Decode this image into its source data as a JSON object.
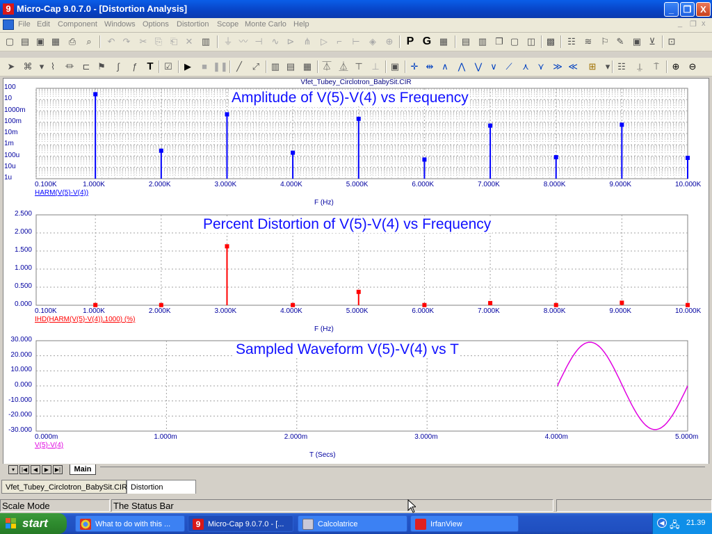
{
  "window": {
    "title": "Micro-Cap 9.0.7.0 - [Distortion Analysis]",
    "app_icon": "9",
    "controls": [
      "_",
      "❐",
      "X"
    ]
  },
  "menu": [
    "File",
    "Edit",
    "Component",
    "Windows",
    "Options",
    "Distortion",
    "Scope",
    "Monte Carlo",
    "Help"
  ],
  "toolbar_text": {
    "p": "P",
    "g": "G",
    "text_tool": "T"
  },
  "plot": {
    "filename": "Vfet_Tubey_Circlotron_BabySit.CIR",
    "colors": {
      "harm": "#0000ff",
      "ihd": "#ff0000",
      "wave": "#e000e0",
      "grid": "#a0a0a0",
      "text": "#0000a0"
    },
    "panels": [
      {
        "title": "Amplitude of V(5)-V(4) vs Frequency",
        "y_ticks": [
          "100",
          "10",
          "1000m",
          "100m",
          "10m",
          "1m",
          "100u",
          "10u",
          "1u"
        ],
        "x_ticks": [
          "0.100K",
          "1.000K",
          "2.000K",
          "3.000K",
          "4.000K",
          "5.000K",
          "6.000K",
          "7.000K",
          "8.000K",
          "9.000K",
          "10.000K"
        ],
        "x_label": "F (Hz)",
        "trace": "HARM(V(5)-V(4))"
      },
      {
        "title": "Percent Distortion of V(5)-V(4) vs Frequency",
        "y_ticks": [
          "2.500",
          "2.000",
          "1.500",
          "1.000",
          "0.500",
          "0.000"
        ],
        "x_ticks": [
          "0.100K",
          "1.000K",
          "2.000K",
          "3.000K",
          "4.000K",
          "5.000K",
          "6.000K",
          "7.000K",
          "8.000K",
          "9.000K",
          "10.000K"
        ],
        "x_label": "F (Hz)",
        "trace": "IHD(HARM(V(5)-V(4)),1000) (%)"
      },
      {
        "title": "Sampled Waveform  V(5)-V(4) vs T",
        "y_ticks": [
          "30.000",
          "20.000",
          "10.000",
          "0.000",
          "-10.000",
          "-20.000",
          "-30.000"
        ],
        "x_ticks": [
          "0.000m",
          "1.000m",
          "2.000m",
          "3.000m",
          "4.000m",
          "5.000m"
        ],
        "x_label": "T (Secs)",
        "trace": "V(5)-V(4)"
      }
    ]
  },
  "chart_data": [
    {
      "type": "bar",
      "title": "Amplitude of V(5)-V(4) vs Frequency",
      "xlabel": "F (Hz)",
      "ylabel": "",
      "series": [
        {
          "name": "HARM(V(5)-V(4))",
          "x": [
            1000,
            2000,
            3000,
            4000,
            5000,
            6000,
            7000,
            8000,
            9000,
            10000
          ],
          "values": [
            30,
            0.0003,
            0.5,
            0.0002,
            0.2,
            5e-05,
            0.05,
            8e-05,
            0.06,
            7e-05
          ]
        }
      ],
      "xlim": [
        100,
        10000
      ],
      "ylim": [
        1e-06,
        100
      ],
      "yscale": "log",
      "grid": true
    },
    {
      "type": "bar",
      "title": "Percent Distortion of V(5)-V(4) vs Frequency",
      "xlabel": "F (Hz)",
      "ylabel": "",
      "series": [
        {
          "name": "IHD(HARM(V(5)-V(4)),1000) (%)",
          "x": [
            1000,
            2000,
            3000,
            4000,
            5000,
            6000,
            7000,
            8000,
            9000,
            10000
          ],
          "values": [
            0.005,
            0.005,
            1.63,
            0.005,
            0.37,
            0.005,
            0.06,
            0.005,
            0.07,
            0.005
          ]
        }
      ],
      "xlim": [
        100,
        10000
      ],
      "ylim": [
        0,
        2.5
      ],
      "grid": true
    },
    {
      "type": "line",
      "title": "Sampled Waveform  V(5)-V(4) vs T",
      "xlabel": "T (Secs)",
      "ylabel": "",
      "series": [
        {
          "name": "V(5)-V(4)",
          "x": [
            4.0,
            4.1,
            4.2,
            4.25,
            4.3,
            4.4,
            4.5,
            4.6,
            4.7,
            4.75,
            4.8,
            4.9,
            5.0
          ],
          "values": [
            0,
            17,
            27.5,
            29,
            27.5,
            17,
            0,
            -17,
            -27.5,
            -29,
            -27.5,
            -17,
            0
          ]
        }
      ],
      "xlim": [
        0,
        5
      ],
      "ylim": [
        -30,
        30
      ],
      "grid": true
    }
  ],
  "sheet_tab": "Main",
  "doc_tabs": [
    "Vfet_Tubey_Circlotron_BabySit.CIR",
    "Distortion Analysis"
  ],
  "status": {
    "mode": "Scale Mode",
    "text": "The Status Bar"
  },
  "taskbar": {
    "start": "start",
    "tasks": [
      "What to do with this ...",
      "Micro-Cap 9.0.7.0 - [...",
      "Calcolatrice",
      "IrfanView"
    ],
    "clock": "21.39"
  }
}
